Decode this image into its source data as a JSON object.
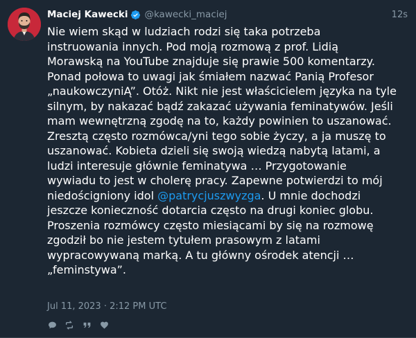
{
  "tweet": {
    "author": {
      "display_name": "Maciej Kawecki",
      "handle": "@kawecki_maciej",
      "verified": true
    },
    "relative_time": "12s",
    "text_before_mention": "Nie wiem skąd w ludziach rodzi się taka potrzeba\ninstruowania innych. Pod moją rozmową z prof. Lidią\nMorawską na YouTube znajduje się prawie 500 komentarzy.\nPonad połowa to uwagi jak śmiałem nazwać Panią Profesor\n„naukowczyniĄ”. Otóż. Nikt nie jest właścicielem języka na tyle\nsilnym, by nakazać bądź zakazać używania feminatywów. Jeśli\nmam wewnętrzną zgodę na to, każdy powinien to uszanować.\nZresztą często rozmówca/yni tego sobie życzy, a ja muszę to\nuszanować. Kobieta dzieli się swoją wiedzą nabytą latami, a\nludzi interesuje głównie feminatywa … Przygotowanie\nwywiadu to jest w cholerę pracy. Zapewne potwierdzi to mój\nniedościgniony idol ",
    "mention": "@patrycjuszwyzga",
    "text_after_mention": ". U mnie dochodzi\njeszcze konieczność dotarcia często na drugi koniec globu.\nProszenia rozmówcy często miesiącami by się na rozmowę\nzgodził bo nie jestem tytułem prasowym z latami\nwypracowywaną marką. A tu główny ośrodek atencji …\n„feminstywa”.",
    "date": "Jul 11, 2023 · 2:12 PM UTC"
  },
  "actions": [
    {
      "icon": "reply-icon"
    },
    {
      "icon": "retweet-icon"
    },
    {
      "icon": "quote-icon"
    },
    {
      "icon": "like-icon"
    }
  ],
  "colors": {
    "background": "#1c2733",
    "text": "#ffffff",
    "muted": "#8899a6",
    "link": "#1d9bf0",
    "verified": "#1d9bf0",
    "avatar_background": "#c8283a"
  }
}
